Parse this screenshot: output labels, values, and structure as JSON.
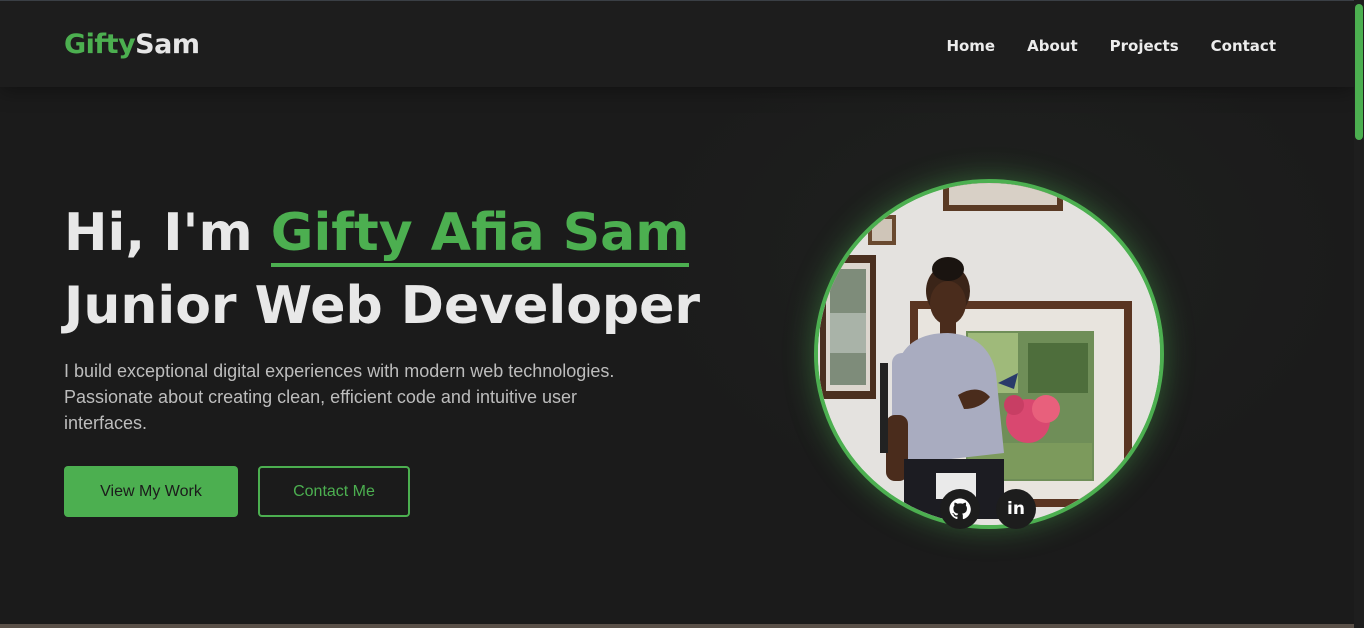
{
  "header": {
    "logo_part1": "Gifty",
    "logo_part2": "Sam",
    "nav": [
      "Home",
      "About",
      "Projects",
      "Contact"
    ]
  },
  "hero": {
    "greeting": "Hi, I'm ",
    "name": "Gifty Afia Sam",
    "role": "Junior Web Developer",
    "description": "I build exceptional digital experiences with modern web technologies. Passionate about creating clean, efficient code and intuitive user interfaces.",
    "primary_button": "View My Work",
    "secondary_button": "Contact Me"
  },
  "social": {
    "github_icon": "github-icon",
    "linkedin_icon": "linkedin-icon",
    "linkedin_text": "in"
  },
  "colors": {
    "accent": "#4caf50",
    "background": "#1b1b1b",
    "text": "#e8e8e8"
  }
}
